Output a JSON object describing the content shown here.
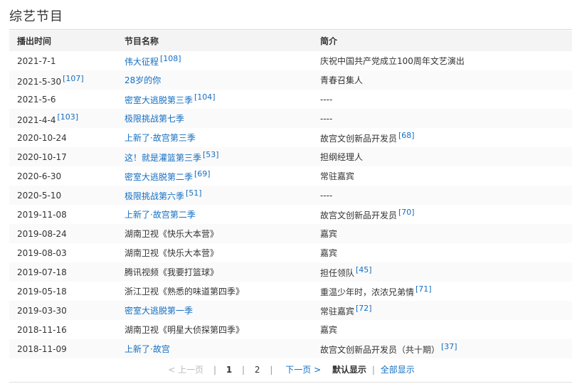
{
  "section": {
    "title": "综艺节目"
  },
  "table": {
    "headers": [
      "播出时间",
      "节目名称",
      "简介"
    ],
    "rows": [
      {
        "date": "2021-7-1",
        "date_ref": "",
        "name": "伟大征程",
        "name_link": true,
        "name_ref": "[108]",
        "desc": "庆祝中国共产党成立100周年文艺演出",
        "desc_ref": ""
      },
      {
        "date": "2021-5-30",
        "date_ref": "[107]",
        "name": "28岁的你",
        "name_link": true,
        "name_ref": "",
        "desc": "青春召集人",
        "desc_ref": ""
      },
      {
        "date": "2021-5-6",
        "date_ref": "",
        "name": "密室大逃脱第三季",
        "name_link": true,
        "name_ref": "[104]",
        "desc": "----",
        "desc_ref": ""
      },
      {
        "date": "2021-4-4",
        "date_ref": "[103]",
        "name": "极限挑战第七季",
        "name_link": true,
        "name_ref": "",
        "desc": "----",
        "desc_ref": ""
      },
      {
        "date": "2020-10-24",
        "date_ref": "",
        "name": "上新了·故宫第三季",
        "name_link": true,
        "name_ref": "",
        "desc": "故宫文创新品开发员",
        "desc_ref": "[68]"
      },
      {
        "date": "2020-10-17",
        "date_ref": "",
        "name": "这！就是灌篮第三季",
        "name_link": true,
        "name_ref": "[53]",
        "desc": "担纲经理人",
        "desc_ref": ""
      },
      {
        "date": "2020-6-30",
        "date_ref": "",
        "name": "密室大逃脱第二季",
        "name_link": true,
        "name_ref": "[69]",
        "desc": "常驻嘉宾",
        "desc_ref": ""
      },
      {
        "date": "2020-5-10",
        "date_ref": "",
        "name": "极限挑战第六季",
        "name_link": true,
        "name_ref": "[51]",
        "desc": "----",
        "desc_ref": ""
      },
      {
        "date": "2019-11-08",
        "date_ref": "",
        "name": "上新了·故宫第二季",
        "name_link": true,
        "name_ref": "",
        "desc": "故宫文创新品开发员",
        "desc_ref": "[70]"
      },
      {
        "date": "2019-08-24",
        "date_ref": "",
        "name": "湖南卫视《快乐大本营》",
        "name_link": false,
        "name_ref": "",
        "desc": "嘉宾",
        "desc_ref": ""
      },
      {
        "date": "2019-08-03",
        "date_ref": "",
        "name": "湖南卫视《快乐大本营》",
        "name_link": false,
        "name_ref": "",
        "desc": "嘉宾",
        "desc_ref": ""
      },
      {
        "date": "2019-07-18",
        "date_ref": "",
        "name": "腾讯视频《我要打篮球》",
        "name_link": false,
        "name_ref": "",
        "desc": "担任领队",
        "desc_ref": "[45]"
      },
      {
        "date": "2019-05-18",
        "date_ref": "",
        "name": "浙江卫视《熟悉的味道第四季》",
        "name_link": false,
        "name_ref": "",
        "desc": "重温少年时，浓浓兄弟情",
        "desc_ref": "[71]"
      },
      {
        "date": "2019-03-30",
        "date_ref": "",
        "name": "密室大逃脱第一季",
        "name_link": true,
        "name_ref": "",
        "desc": "常驻嘉宾",
        "desc_ref": "[72]"
      },
      {
        "date": "2018-11-16",
        "date_ref": "",
        "name": "湖南卫视《明星大侦探第四季》",
        "name_link": false,
        "name_ref": "",
        "desc": "嘉宾",
        "desc_ref": ""
      },
      {
        "date": "2018-11-09",
        "date_ref": "",
        "name": "上新了·故宫",
        "name_link": true,
        "name_ref": "",
        "desc": "故宫文创新品开发员（共十期）",
        "desc_ref": "[37]"
      }
    ]
  },
  "pager": {
    "prev": "< 上一页",
    "current": "1",
    "page2": "2",
    "next": "下一页 >",
    "default_view": "默认显示",
    "separator": "|",
    "show_all": "全部显示"
  }
}
